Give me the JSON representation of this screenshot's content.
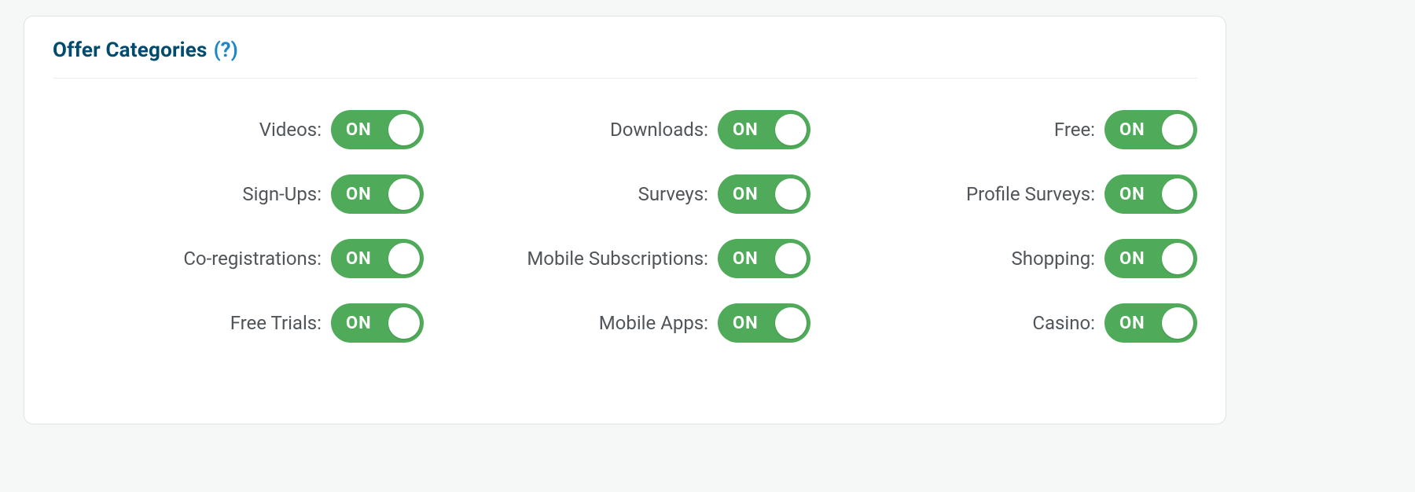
{
  "section": {
    "title": "Offer Categories",
    "help": "(?)",
    "toggle_on_text": "ON"
  },
  "categories": {
    "col1": [
      {
        "label": "Videos:",
        "state": "on"
      },
      {
        "label": "Sign-Ups:",
        "state": "on"
      },
      {
        "label": "Co-registrations:",
        "state": "on"
      },
      {
        "label": "Free Trials:",
        "state": "on"
      }
    ],
    "col2": [
      {
        "label": "Downloads:",
        "state": "on"
      },
      {
        "label": "Surveys:",
        "state": "on"
      },
      {
        "label": "Mobile Subscriptions:",
        "state": "on"
      },
      {
        "label": "Mobile Apps:",
        "state": "on"
      }
    ],
    "col3": [
      {
        "label": "Free:",
        "state": "on"
      },
      {
        "label": "Profile Surveys:",
        "state": "on"
      },
      {
        "label": "Shopping:",
        "state": "on"
      },
      {
        "label": "Casino:",
        "state": "on"
      }
    ]
  }
}
